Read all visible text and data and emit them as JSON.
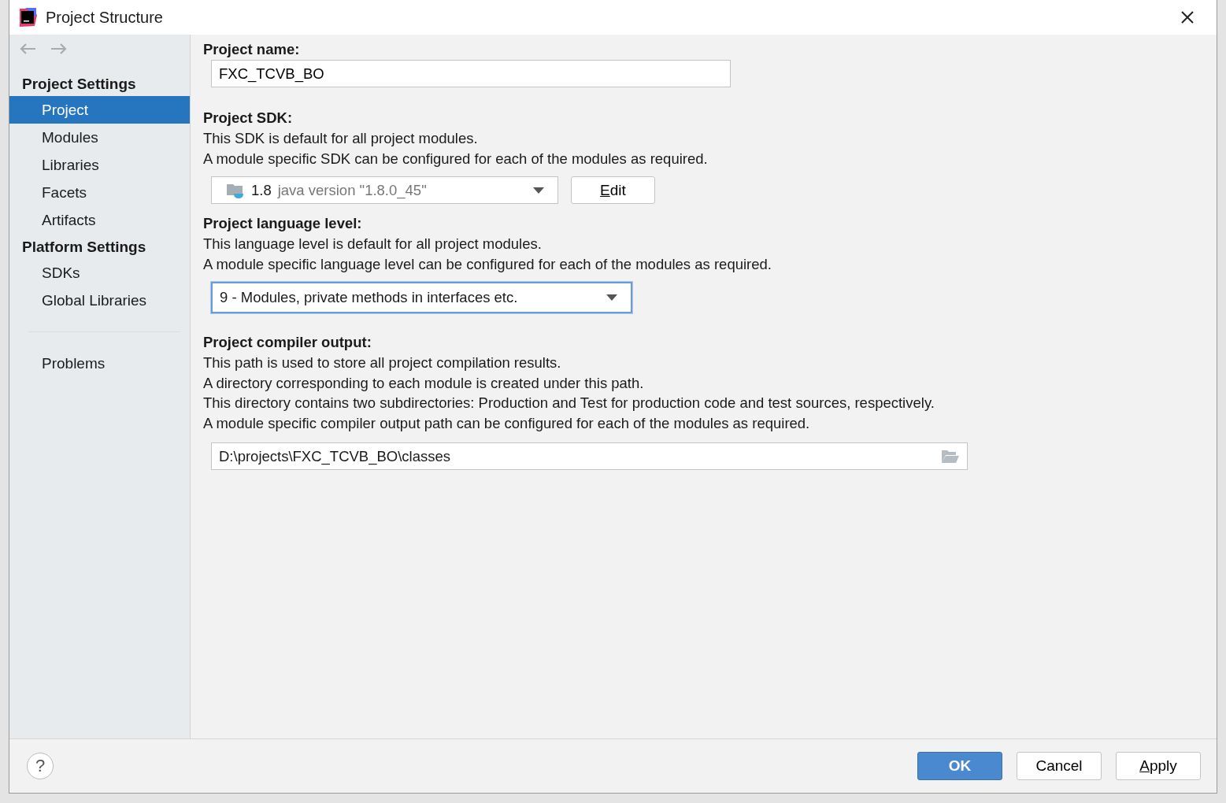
{
  "window": {
    "title": "Project Structure"
  },
  "sidebar": {
    "sections": [
      {
        "heading": "Project Settings",
        "items": [
          {
            "label": "Project",
            "selected": true
          },
          {
            "label": "Modules",
            "selected": false
          },
          {
            "label": "Libraries",
            "selected": false
          },
          {
            "label": "Facets",
            "selected": false
          },
          {
            "label": "Artifacts",
            "selected": false
          }
        ]
      },
      {
        "heading": "Platform Settings",
        "items": [
          {
            "label": "SDKs",
            "selected": false
          },
          {
            "label": "Global Libraries",
            "selected": false
          }
        ]
      }
    ],
    "extra_items": [
      {
        "label": "Problems",
        "selected": false
      }
    ]
  },
  "project_name": {
    "label": "Project name:",
    "value": "FXC_TCVB_BO"
  },
  "project_sdk": {
    "label": "Project SDK:",
    "descriptions": [
      "This SDK is default for all project modules.",
      "A module specific SDK can be configured for each of the modules as required."
    ],
    "dropdown": {
      "name": "1.8",
      "detail": "java version \"1.8.0_45\"",
      "focused": false
    },
    "button": {
      "label": "Edit",
      "mnemonic_underlined": true
    }
  },
  "language_level": {
    "label": "Project language level:",
    "descriptions": [
      "This language level is default for all project modules.",
      "A module specific language level can be configured for each of the modules as required."
    ],
    "dropdown": {
      "value": "9 - Modules, private methods in interfaces etc.",
      "focused": true
    }
  },
  "compiler_output": {
    "label": "Project compiler output:",
    "descriptions": [
      "This path is used to store all project compilation results.",
      "A directory corresponding to each module is created under this path.",
      "This directory contains two subdirectories: Production and Test for production code and test sources, respectively.",
      "A module specific compiler output path can be configured for each of the modules as required."
    ],
    "path": "D:\\projects\\FXC_TCVB_BO\\classes"
  },
  "help": {
    "label": "?"
  },
  "buttons": [
    {
      "label": "OK",
      "default": true,
      "mnemonic_underlined": false
    },
    {
      "label": "Cancel",
      "default": false,
      "mnemonic_underlined": false
    },
    {
      "label": "Apply",
      "default": false,
      "mnemonic_underlined": true
    }
  ]
}
